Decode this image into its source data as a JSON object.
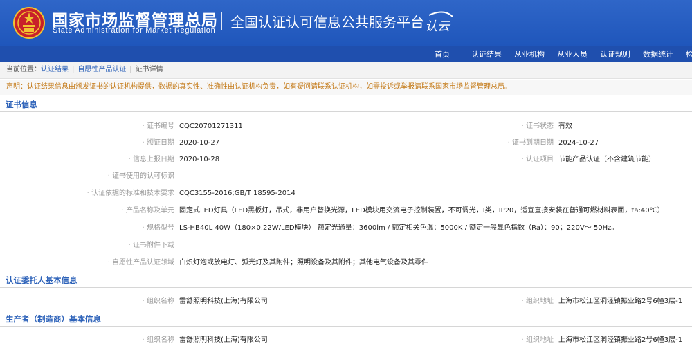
{
  "header": {
    "org_name_cn": "国家市场监督管理总局",
    "org_name_en": "State Administration  for  Market Regulation",
    "platform_title": "全国认证认可信息公共服务平台",
    "logo_text": "认云"
  },
  "nav": {
    "items": [
      "首页",
      "认证结果",
      "从业机构",
      "从业人员",
      "认证规则",
      "数据统计",
      "检"
    ]
  },
  "breadcrumb": {
    "label": "当前位置：",
    "items": [
      "认证结果",
      "自愿性产品认证",
      "证书详情"
    ]
  },
  "notice": "声明：认证结果信息由颁发证书的认证机构提供，数据的真实性、准确性由认证机构负责，如有疑问请联系认证机构，如需投诉或举报请联系国家市场监督管理总局。",
  "cert_info": {
    "title": "证书信息",
    "left": [
      {
        "label": "证书编号",
        "value": "CQC20701271311"
      },
      {
        "label": "颁证日期",
        "value": "2020-10-27"
      },
      {
        "label": "信息上报日期",
        "value": "2020-10-28"
      },
      {
        "label": "证书使用的认可标识",
        "value": ""
      },
      {
        "label": "认证依据的标准和技术要求",
        "value": "CQC3155-2016;GB/T 18595-2014"
      },
      {
        "label": "产品名称及单元",
        "value": "固定式LED灯具（LED黑板灯，吊式，非用户替换光源，LED模块用交流电子控制装置，不可调光，Ⅰ类，IP20，适宜直接安装在普通可燃材料表面，ta:40℃）"
      },
      {
        "label": "规格型号",
        "value": "LS-HB40L 40W（180×0.22W/LED模块） 额定光通量：3600lm / 额定相关色温：5000K / 额定一般显色指数（Ra）：90；220V～ 50Hz。"
      },
      {
        "label": "证书附件下载",
        "value": ""
      },
      {
        "label": "自愿性产品认证领域",
        "value": "白炽灯泡或放电灯、弧光灯及其附件；照明设备及其附件；其他电气设备及其零件"
      }
    ],
    "right": [
      {
        "label": "证书状态",
        "value": "有效"
      },
      {
        "label": "证书到期日期",
        "value": "2024-10-27"
      },
      {
        "label": "认证项目",
        "value": "节能产品认证（不含建筑节能）"
      }
    ]
  },
  "client_info": {
    "title": "认证委托人基本信息",
    "org_label": "组织名称",
    "org_value": "雷舒照明科技(上海)有限公司",
    "addr_label": "组织地址",
    "addr_value": "上海市松江区洞泾镇振业路2号6幢3层-1"
  },
  "maker_info": {
    "title": "生产者（制造商）基本信息",
    "org_label": "组织名称",
    "org_value": "雷舒照明科技(上海)有限公司",
    "addr_label": "组织地址",
    "addr_value": "上海市松江区洞泾镇振业路2号6幢3层-1"
  },
  "colors": {
    "header_blue": "#2f66c8",
    "nav_blue": "#1f4fae",
    "link_blue": "#2d62b9",
    "notice_orange": "#c47a18"
  }
}
